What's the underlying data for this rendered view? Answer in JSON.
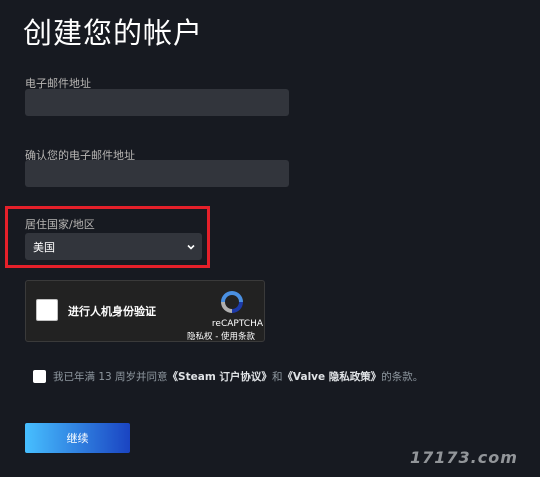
{
  "page": {
    "title": "创建您的帐户"
  },
  "email": {
    "label": "电子邮件地址",
    "value": ""
  },
  "confirm_email": {
    "label": "确认您的电子邮件地址",
    "value": ""
  },
  "country": {
    "label": "居住国家/地区",
    "selected": "美国"
  },
  "recaptcha": {
    "label": "进行人机身份验证",
    "brand": "reCAPTCHA",
    "links": "隐私权 - 使用条款"
  },
  "agreement": {
    "prefix": "我已年满 13 周岁并同意",
    "link1": "《Steam 订户协议》",
    "middle": "和",
    "link2": "《Valve 隐私政策》",
    "suffix": "的条款。"
  },
  "continue_button": {
    "label": "继续"
  },
  "watermark": {
    "text": "17173.com"
  },
  "colors": {
    "background": "#171a21",
    "input": "#32353c",
    "highlight": "#e5202a",
    "button_start": "#47bfff",
    "button_end": "#1a44c2"
  }
}
